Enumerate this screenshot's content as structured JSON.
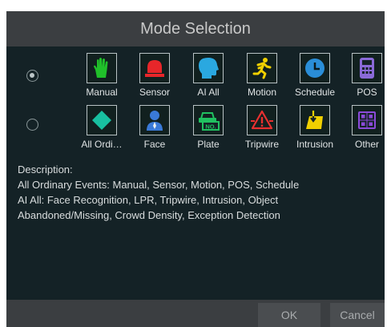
{
  "dialog": {
    "title": "Mode Selection"
  },
  "rows": [
    {
      "selected": true,
      "modes": [
        {
          "label": "Manual",
          "icon": "hand-icon"
        },
        {
          "label": "Sensor",
          "icon": "alarm-light-icon"
        },
        {
          "label": "AI All",
          "icon": "ai-head-icon"
        },
        {
          "label": "Motion",
          "icon": "running-person-icon"
        },
        {
          "label": "Schedule",
          "icon": "clock-icon"
        },
        {
          "label": "POS",
          "icon": "pos-terminal-icon"
        }
      ]
    },
    {
      "selected": false,
      "modes": [
        {
          "label": "All Ordi…",
          "icon": "diamond-icon"
        },
        {
          "label": "Face",
          "icon": "person-face-icon"
        },
        {
          "label": "Plate",
          "icon": "car-plate-icon"
        },
        {
          "label": "Tripwire",
          "icon": "tripwire-warning-icon"
        },
        {
          "label": "Intrusion",
          "icon": "intrusion-icon"
        },
        {
          "label": "Other",
          "icon": "grid-squares-icon"
        }
      ]
    }
  ],
  "plate_icon_text": "NO.",
  "description": {
    "heading": "Description:",
    "lines": [
      "All Ordinary Events: Manual, Sensor, Motion, POS, Schedule",
      "AI All: Face Recognition, LPR, Tripwire, Intrusion, Object",
      "Abandoned/Missing, Crowd Density, Exception Detection"
    ]
  },
  "buttons": {
    "ok": "OK",
    "cancel": "Cancel"
  },
  "colors": {
    "background": "#142226",
    "titlebar": "#3b3e41",
    "manual": "#20c02a",
    "sensor": "#e8262a",
    "ai_all": "#2aa8e0",
    "motion": "#f0d000",
    "schedule": "#2a8ed8",
    "pos": "#8a6ad8",
    "diamond": "#18c0a0",
    "face": "#3a7ad8",
    "plate": "#20c060",
    "tripwire": "#e83030",
    "intrusion": "#f0d000",
    "other": "#8a4ad8"
  }
}
